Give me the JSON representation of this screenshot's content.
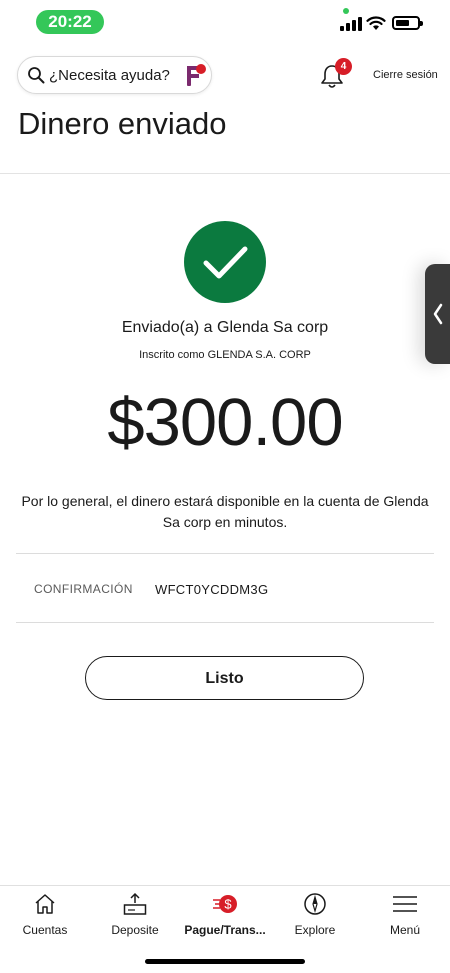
{
  "status_bar": {
    "time": "20:22"
  },
  "header": {
    "search_placeholder": "¿Necesita ayuda?",
    "notification_count": "4",
    "logout_label": "Cierre sesión",
    "title": "Dinero enviado"
  },
  "confirmation": {
    "sent_to": "Enviado(a) a Glenda Sa corp",
    "enrolled_as": "Inscrito como GLENDA S.A. CORP",
    "amount": "$300.00",
    "availability": "Por lo general, el dinero estará disponible en la cuenta de Glenda Sa corp en minutos.",
    "confirmation_label": "CONFIRMACIÓN",
    "confirmation_code": "WFCT0YCDDM3G",
    "done_label": "Listo"
  },
  "nav": {
    "items": [
      {
        "label": "Cuentas",
        "icon": "home-icon"
      },
      {
        "label": "Deposite",
        "icon": "deposit-icon"
      },
      {
        "label": "Pague/Trans...",
        "icon": "pay-transfer-icon"
      },
      {
        "label": "Explore",
        "icon": "compass-icon"
      },
      {
        "label": "Menú",
        "icon": "menu-icon"
      }
    ]
  },
  "colors": {
    "success": "#0b7a3f",
    "brand_red": "#d71e28",
    "status_green": "#34c759"
  }
}
